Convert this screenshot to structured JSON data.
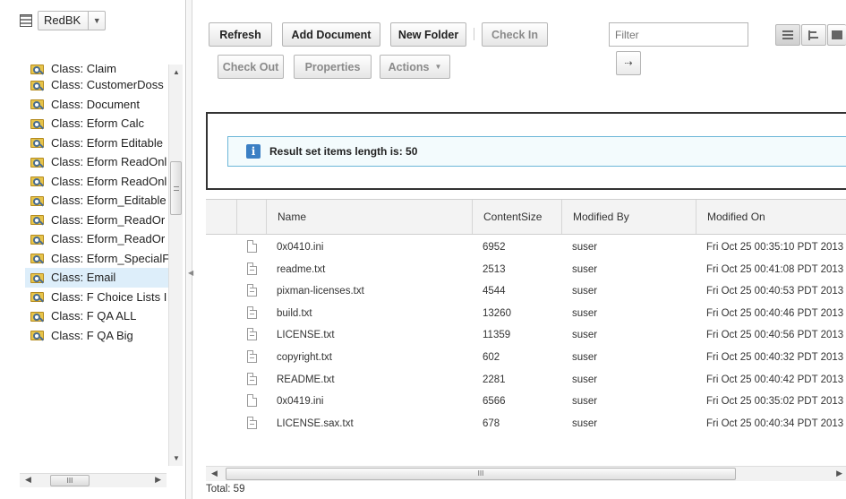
{
  "left_panel": {
    "repository": "RedBK",
    "tree_items": [
      {
        "label": "Class: Claim",
        "partial": true
      },
      {
        "label": "Class: CustomerDoss"
      },
      {
        "label": "Class: Document"
      },
      {
        "label": "Class: Eform Calc"
      },
      {
        "label": "Class: Eform Editable"
      },
      {
        "label": "Class: Eform ReadOnl"
      },
      {
        "label": "Class: Eform ReadOnl"
      },
      {
        "label": "Class: Eform_Editable"
      },
      {
        "label": "Class: Eform_ReadOr"
      },
      {
        "label": "Class: Eform_ReadOr"
      },
      {
        "label": "Class: Eform_SpecialF"
      },
      {
        "label": "Class: Email",
        "selected": true
      },
      {
        "label": "Class: F Choice Lists I"
      },
      {
        "label": "Class: F QA ALL"
      },
      {
        "label": "Class: F QA Big"
      }
    ],
    "hscroll_grip": "III"
  },
  "toolbar": {
    "refresh": "Refresh",
    "add_document": "Add Document",
    "new_folder": "New Folder",
    "check_in": "Check In",
    "check_out": "Check Out",
    "properties": "Properties",
    "actions": "Actions",
    "filter_placeholder": "Filter"
  },
  "message": {
    "text": "Result set items length is: 50"
  },
  "grid": {
    "columns": [
      "Name",
      "ContentSize",
      "Modified By",
      "Modified On"
    ],
    "rows": [
      {
        "name": "0x0410.ini",
        "size": "6952",
        "by": "suser",
        "on": "Fri Oct 25 00:35:10 PDT 2013",
        "icon": "blank"
      },
      {
        "name": "readme.txt",
        "size": "2513",
        "by": "suser",
        "on": "Fri Oct 25 00:41:08 PDT 2013",
        "icon": "text"
      },
      {
        "name": "pixman-licenses.txt",
        "size": "4544",
        "by": "suser",
        "on": "Fri Oct 25 00:40:53 PDT 2013",
        "icon": "text"
      },
      {
        "name": "build.txt",
        "size": "13260",
        "by": "suser",
        "on": "Fri Oct 25 00:40:46 PDT 2013",
        "icon": "text"
      },
      {
        "name": "LICENSE.txt",
        "size": "11359",
        "by": "suser",
        "on": "Fri Oct 25 00:40:56 PDT 2013",
        "icon": "text"
      },
      {
        "name": "copyright.txt",
        "size": "602",
        "by": "suser",
        "on": "Fri Oct 25 00:40:32 PDT 2013",
        "icon": "text"
      },
      {
        "name": "README.txt",
        "size": "2281",
        "by": "suser",
        "on": "Fri Oct 25 00:40:42 PDT 2013",
        "icon": "text"
      },
      {
        "name": "0x0419.ini",
        "size": "6566",
        "by": "suser",
        "on": "Fri Oct 25 00:35:02 PDT 2013",
        "icon": "blank"
      },
      {
        "name": "LICENSE.sax.txt",
        "size": "678",
        "by": "suser",
        "on": "Fri Oct 25 00:40:34 PDT 2013",
        "icon": "text"
      }
    ],
    "hscroll_grip": "III"
  },
  "footer": {
    "total": "Total: 59"
  }
}
